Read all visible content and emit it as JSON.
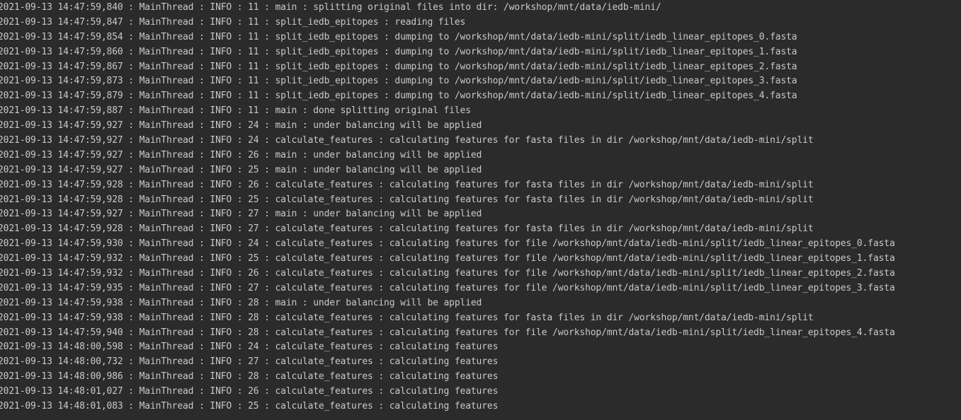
{
  "console": {
    "lines": [
      "2021-09-13 14:47:59,840 : MainThread : INFO : 11 : main : splitting original files into dir: /workshop/mnt/data/iedb-mini/",
      "2021-09-13 14:47:59,847 : MainThread : INFO : 11 : split_iedb_epitopes : reading files",
      "2021-09-13 14:47:59,854 : MainThread : INFO : 11 : split_iedb_epitopes : dumping to /workshop/mnt/data/iedb-mini/split/iedb_linear_epitopes_0.fasta",
      "2021-09-13 14:47:59,860 : MainThread : INFO : 11 : split_iedb_epitopes : dumping to /workshop/mnt/data/iedb-mini/split/iedb_linear_epitopes_1.fasta",
      "2021-09-13 14:47:59,867 : MainThread : INFO : 11 : split_iedb_epitopes : dumping to /workshop/mnt/data/iedb-mini/split/iedb_linear_epitopes_2.fasta",
      "2021-09-13 14:47:59,873 : MainThread : INFO : 11 : split_iedb_epitopes : dumping to /workshop/mnt/data/iedb-mini/split/iedb_linear_epitopes_3.fasta",
      "2021-09-13 14:47:59,879 : MainThread : INFO : 11 : split_iedb_epitopes : dumping to /workshop/mnt/data/iedb-mini/split/iedb_linear_epitopes_4.fasta",
      "2021-09-13 14:47:59,887 : MainThread : INFO : 11 : main : done splitting original files",
      "2021-09-13 14:47:59,927 : MainThread : INFO : 24 : main : under balancing will be applied",
      "2021-09-13 14:47:59,927 : MainThread : INFO : 24 : calculate_features : calculating features for fasta files in dir /workshop/mnt/data/iedb-mini/split",
      "2021-09-13 14:47:59,927 : MainThread : INFO : 26 : main : under balancing will be applied",
      "2021-09-13 14:47:59,927 : MainThread : INFO : 25 : main : under balancing will be applied",
      "2021-09-13 14:47:59,928 : MainThread : INFO : 26 : calculate_features : calculating features for fasta files in dir /workshop/mnt/data/iedb-mini/split",
      "2021-09-13 14:47:59,928 : MainThread : INFO : 25 : calculate_features : calculating features for fasta files in dir /workshop/mnt/data/iedb-mini/split",
      "2021-09-13 14:47:59,927 : MainThread : INFO : 27 : main : under balancing will be applied",
      "2021-09-13 14:47:59,928 : MainThread : INFO : 27 : calculate_features : calculating features for fasta files in dir /workshop/mnt/data/iedb-mini/split",
      "2021-09-13 14:47:59,930 : MainThread : INFO : 24 : calculate_features : calculating features for file /workshop/mnt/data/iedb-mini/split/iedb_linear_epitopes_0.fasta",
      "2021-09-13 14:47:59,932 : MainThread : INFO : 25 : calculate_features : calculating features for file /workshop/mnt/data/iedb-mini/split/iedb_linear_epitopes_1.fasta",
      "2021-09-13 14:47:59,932 : MainThread : INFO : 26 : calculate_features : calculating features for file /workshop/mnt/data/iedb-mini/split/iedb_linear_epitopes_2.fasta",
      "2021-09-13 14:47:59,935 : MainThread : INFO : 27 : calculate_features : calculating features for file /workshop/mnt/data/iedb-mini/split/iedb_linear_epitopes_3.fasta",
      "2021-09-13 14:47:59,938 : MainThread : INFO : 28 : main : under balancing will be applied",
      "2021-09-13 14:47:59,938 : MainThread : INFO : 28 : calculate_features : calculating features for fasta files in dir /workshop/mnt/data/iedb-mini/split",
      "2021-09-13 14:47:59,940 : MainThread : INFO : 28 : calculate_features : calculating features for file /workshop/mnt/data/iedb-mini/split/iedb_linear_epitopes_4.fasta",
      "2021-09-13 14:48:00,598 : MainThread : INFO : 24 : calculate_features : calculating features",
      "2021-09-13 14:48:00,732 : MainThread : INFO : 27 : calculate_features : calculating features",
      "2021-09-13 14:48:00,986 : MainThread : INFO : 28 : calculate_features : calculating features",
      "2021-09-13 14:48:01,027 : MainThread : INFO : 26 : calculate_features : calculating features",
      "2021-09-13 14:48:01,083 : MainThread : INFO : 25 : calculate_features : calculating features"
    ]
  }
}
